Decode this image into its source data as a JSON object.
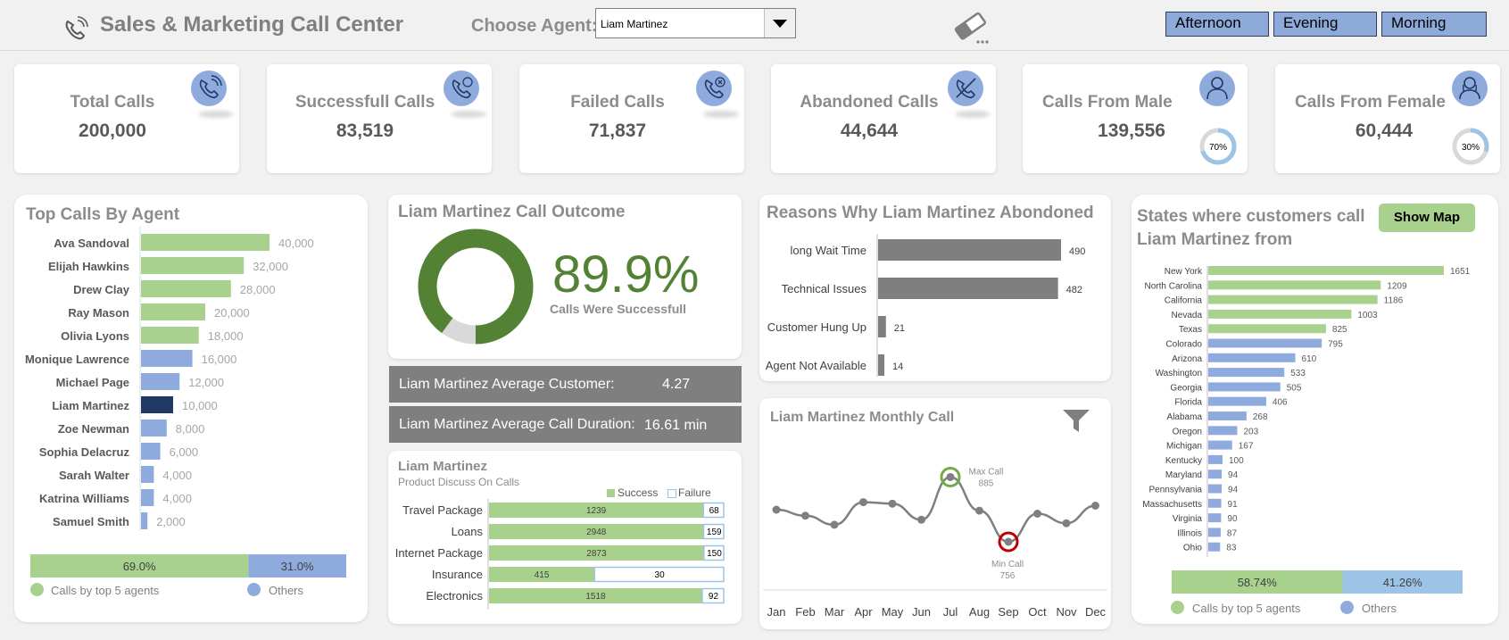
{
  "header": {
    "title": "Sales & Marketing Call Center",
    "agent_label": "Choose Agent:",
    "agent_selected": "Liam Martinez",
    "slicers": [
      "Afternoon",
      "Evening",
      "Morning"
    ]
  },
  "kpis": [
    {
      "label": "Total Calls",
      "value": "200,000",
      "icon": "phone-ring-icon"
    },
    {
      "label": "Successfull Calls",
      "value": "83,519",
      "icon": "phone-check-icon"
    },
    {
      "label": "Failed Calls",
      "value": "71,837",
      "icon": "phone-x-icon"
    },
    {
      "label": "Abandoned Calls",
      "value": "44,644",
      "icon": "phone-off-icon"
    },
    {
      "label": "Calls From Male",
      "value": "139,556",
      "icon": "male-user-icon",
      "pct_label": "70%",
      "pct": 0.7
    },
    {
      "label": "Calls From Female",
      "value": "60,444",
      "icon": "female-user-icon",
      "pct_label": "30%",
      "pct": 0.3
    }
  ],
  "top_agents": {
    "title": "Top Calls By Agent",
    "legend_top5": "Calls by top 5 agents",
    "legend_others": "Others"
  },
  "outcome": {
    "title": "Liam Martinez Call Outcome",
    "big_value": "89.9%",
    "subtitle": "Calls Were Successfull",
    "avg_customer_label": "Liam Martinez Average Customer:",
    "avg_customer_value": "4.27",
    "avg_duration_label": "Liam Martinez Average Call Duration:",
    "avg_duration_value": "16.61 min"
  },
  "products": {
    "title": "Liam Martinez",
    "subtitle": "Product Discuss On Calls",
    "legend_success": "Success",
    "legend_failure": "Failure"
  },
  "reasons": {
    "title": "Reasons Why Liam Martinez Abondoned"
  },
  "monthly": {
    "title": "Liam Martinez Monthly Call",
    "max_label": "Max Call",
    "min_label": "Min Call"
  },
  "states": {
    "title_line1": "States where customers call",
    "title_line2": "Liam Martinez from",
    "show_map": "Show Map",
    "legend_top5": "Calls by top 5 agents",
    "legend_others": "Others"
  },
  "colors": {
    "green": "#a9d18e",
    "blue": "#8faadc",
    "navy": "#203864",
    "dark_green": "#548235",
    "gray": "#7f7f7f",
    "light_blue": "#9dc3e6"
  },
  "chart_data": [
    {
      "type": "bar",
      "orientation": "horizontal",
      "categories": [
        "Ava Sandoval",
        "Elijah Hawkins",
        "Drew Clay",
        "Ray Mason",
        "Olivia Lyons",
        "Monique Lawrence",
        "Michael Page",
        "Liam Martinez",
        "Zoe Newman",
        "Sophia Delacruz",
        "Sarah Walter",
        "Katrina Williams",
        "Samuel Smith"
      ],
      "values": [
        40000,
        32000,
        28000,
        20000,
        18000,
        16000,
        12000,
        10000,
        8000,
        6000,
        4000,
        4000,
        2000
      ],
      "value_labels": [
        "40,000",
        "32,000",
        "28,000",
        "20,000",
        "18,000",
        "16,000",
        "12,000",
        "10,000",
        "8,000",
        "6,000",
        "4,000",
        "4,000",
        "2,000"
      ],
      "xlim": [
        0,
        55000
      ]
    },
    {
      "type": "bar",
      "orientation": "horizontal-stacked",
      "categories": [
        "Calls by top 5 agents",
        "Others"
      ],
      "values": [
        69.0,
        31.0
      ],
      "value_labels": [
        "69.0%",
        "31.0%"
      ]
    },
    {
      "type": "pie",
      "style": "donut",
      "categories": [
        "Success",
        "Other"
      ],
      "values": [
        89.9,
        10.1
      ]
    },
    {
      "type": "bar",
      "orientation": "horizontal",
      "categories": [
        "long Wait Time",
        "Technical Issues",
        "Customer Hung Up",
        "Agent Not Available"
      ],
      "values": [
        490,
        482,
        21,
        14
      ],
      "xlim": [
        0,
        580
      ]
    },
    {
      "type": "bar",
      "orientation": "horizontal-stacked",
      "categories": [
        "Travel Package",
        "Loans",
        "Internet Package",
        "Insurance",
        "Electronics"
      ],
      "series": [
        {
          "name": "Success",
          "values": [
            1239,
            2948,
            2873,
            415,
            1518
          ]
        },
        {
          "name": "Failure",
          "values": [
            68,
            159,
            150,
            30,
            92
          ]
        }
      ]
    },
    {
      "type": "line",
      "x": [
        "Jan",
        "Feb",
        "Mar",
        "Apr",
        "May",
        "Jun",
        "Jul",
        "Aug",
        "Sep",
        "Oct",
        "Nov",
        "Dec"
      ],
      "values": [
        820,
        808,
        790,
        835,
        832,
        800,
        885,
        818,
        756,
        812,
        793,
        828
      ],
      "max": {
        "month": "Jul",
        "value": 885
      },
      "min": {
        "month": "Sep",
        "value": 756
      },
      "ylim": [
        740,
        900
      ]
    },
    {
      "type": "bar",
      "orientation": "horizontal",
      "categories": [
        "New York",
        "North Carolina",
        "California",
        "Nevada",
        "Texas",
        "Colorado",
        "Arizona",
        "Washington",
        "Georgia",
        "Florida",
        "Alabama",
        "Oregon",
        "Michigan",
        "Kentucky",
        "Maryland",
        "Pennsylvania",
        "Massachusetts",
        "Virginia",
        "Illinois",
        "Ohio"
      ],
      "values": [
        1651,
        1209,
        1186,
        1003,
        825,
        795,
        610,
        533,
        505,
        406,
        268,
        203,
        167,
        100,
        94,
        94,
        91,
        90,
        87,
        83
      ],
      "xlim": [
        0,
        1700
      ]
    },
    {
      "type": "bar",
      "orientation": "horizontal-stacked",
      "categories": [
        "Calls by top 5 agents",
        "Others"
      ],
      "values": [
        58.74,
        41.26
      ],
      "value_labels": [
        "58.74%",
        "41.26%"
      ]
    }
  ]
}
